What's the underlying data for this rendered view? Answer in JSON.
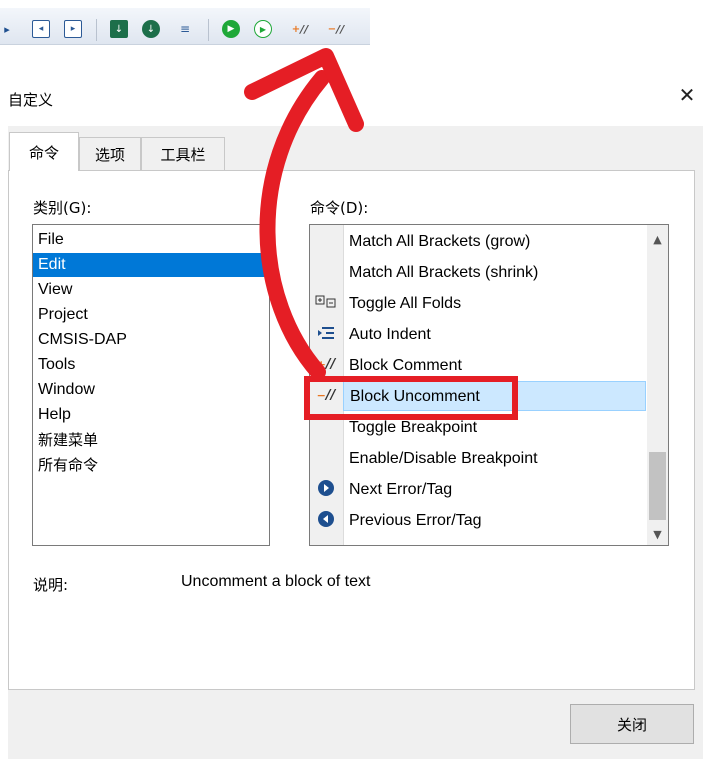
{
  "toolbar": {
    "icons": [
      "chevron-right-icon",
      "step-back-icon",
      "step-forward-icon",
      "download-icon",
      "shield-down-icon",
      "list-indent-icon",
      "run-icon",
      "play-icon",
      "block-comment-icon",
      "block-uncomment-icon"
    ],
    "comment_glyph": "//"
  },
  "dialog": {
    "title": "自定义",
    "close_glyph": "✕"
  },
  "tabs": [
    {
      "label": "命令",
      "active": true
    },
    {
      "label": "选项",
      "active": false
    },
    {
      "label": "工具栏",
      "active": false
    }
  ],
  "categories": {
    "label": "类别(G):",
    "items": [
      "File",
      "Edit",
      "View",
      "Project",
      "CMSIS-DAP",
      "Tools",
      "Window",
      "Help",
      "新建菜单",
      "所有命令"
    ],
    "selected": "Edit"
  },
  "commands": {
    "label": "命令(D):",
    "items": [
      {
        "label": "Match All Brackets (grow)",
        "icon": ""
      },
      {
        "label": "Match All Brackets (shrink)",
        "icon": ""
      },
      {
        "label": "Toggle All Folds",
        "icon": "fold-icon"
      },
      {
        "label": "Auto Indent",
        "icon": "indent-icon"
      },
      {
        "label": "Block Comment",
        "icon": "block-comment-icon"
      },
      {
        "label": "Block Uncomment",
        "icon": "block-uncomment-icon"
      },
      {
        "label": "Toggle Breakpoint",
        "icon": ""
      },
      {
        "label": "Enable/Disable Breakpoint",
        "icon": ""
      },
      {
        "label": "Next Error/Tag",
        "icon": "next-arrow-icon"
      },
      {
        "label": "Previous Error/Tag",
        "icon": "previous-arrow-icon"
      }
    ],
    "selected": "Block Uncomment",
    "scroll_up": "▲",
    "scroll_down": "▼"
  },
  "description": {
    "label": "说明:",
    "text": "Uncomment a block of text"
  },
  "close_button": "关闭",
  "colors": {
    "selection_blue": "#0078d7",
    "highlight_red": "#e51e25",
    "comment_orange": "#e87722",
    "run_green": "#1fa838"
  }
}
